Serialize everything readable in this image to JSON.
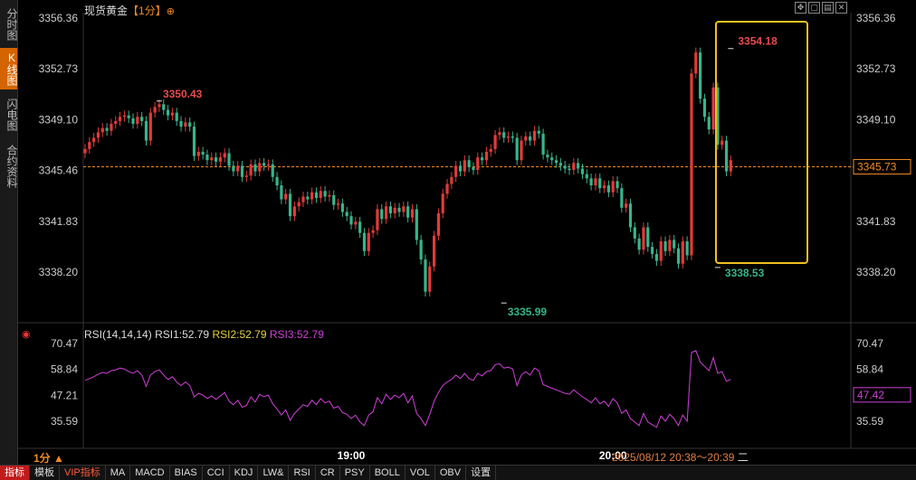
{
  "sidebar": {
    "tabs": [
      {
        "label": "分时图",
        "active": false
      },
      {
        "label": "K线图",
        "active": true
      },
      {
        "label": "闪电图",
        "active": false
      },
      {
        "label": "合约资料",
        "active": false
      }
    ]
  },
  "header": {
    "title": "现货黄金",
    "period": "【1分】",
    "settings_icon": "circle-plus-icon",
    "window_icons": [
      "resize-icon",
      "restore-icon",
      "panel-icon",
      "close-icon"
    ]
  },
  "rsi_panel": {
    "label": "RSI(14,14,14)",
    "rsi1": "RSI1:52.79",
    "rsi2": "RSI2:52.79",
    "rsi3": "RSI3:52.79",
    "current_value": "47.42"
  },
  "footer": {
    "period_label": "1分",
    "time_range": "2025/08/12 20:38～20:39",
    "weekday": "二"
  },
  "toolbar": [
    "指标",
    "模板",
    "VIP指标",
    "MA",
    "MACD",
    "BIAS",
    "CCI",
    "KDJ",
    "LW&",
    "RSI",
    "CR",
    "PSY",
    "BOLL",
    "VOL",
    "OBV",
    "设置"
  ],
  "chart_data": {
    "type": "candlestick",
    "ylim": [
      3334.9,
      3357.0
    ],
    "y_ticks": [
      "3356.36",
      "3352.73",
      "3349.10",
      "3345.46",
      "3341.83",
      "3338.20"
    ],
    "current_price": "3345.73",
    "x_labels": [
      {
        "label": "19:00",
        "index": 61
      },
      {
        "label": "20:00",
        "index": 121
      }
    ],
    "annotations": {
      "high_left": {
        "value": "3350.43",
        "index": 17
      },
      "low": {
        "value": "3335.99",
        "index": 96
      },
      "high_right": {
        "value": "3354.18",
        "index": 148
      },
      "low_right": {
        "value": "3338.53",
        "index": 145
      }
    },
    "close": [
      3347.0,
      3347.5,
      3347.8,
      3348.2,
      3348.5,
      3348.3,
      3348.8,
      3349.0,
      3349.3,
      3349.4,
      3349.2,
      3348.8,
      3349.3,
      3349.0,
      3347.6,
      3349.6,
      3350.0,
      3350.2,
      3349.8,
      3349.4,
      3349.6,
      3349.0,
      3348.6,
      3348.9,
      3348.6,
      3346.5,
      3346.8,
      3346.6,
      3346.2,
      3346.4,
      3346.1,
      3346.4,
      3346.7,
      3345.8,
      3345.4,
      3345.8,
      3345.0,
      3345.1,
      3345.9,
      3345.4,
      3346.0,
      3345.8,
      3345.9,
      3345.0,
      3344.4,
      3343.4,
      3343.8,
      3342.2,
      3342.9,
      3343.2,
      3343.6,
      3343.4,
      3343.9,
      3343.5,
      3344.0,
      3343.6,
      3343.7,
      3343.0,
      3343.1,
      3342.5,
      3342.2,
      3341.6,
      3341.8,
      3341.0,
      3339.7,
      3341.0,
      3341.2,
      3342.7,
      3342.0,
      3342.9,
      3342.4,
      3342.8,
      3342.5,
      3342.9,
      3342.1,
      3342.7,
      3340.5,
      3339.1,
      3336.8,
      3338.6,
      3340.8,
      3342.4,
      3343.8,
      3344.5,
      3345.0,
      3345.8,
      3345.4,
      3346.2,
      3345.7,
      3345.5,
      3346.4,
      3346.2,
      3346.8,
      3347.0,
      3348.0,
      3348.2,
      3347.8,
      3347.9,
      3347.8,
      3346.2,
      3347.6,
      3347.9,
      3347.6,
      3348.3,
      3348.1,
      3346.6,
      3346.4,
      3346.2,
      3346.0,
      3345.8,
      3345.6,
      3345.5,
      3346.0,
      3345.6,
      3345.2,
      3344.9,
      3344.4,
      3344.9,
      3344.2,
      3344.4,
      3343.9,
      3344.7,
      3344.2,
      3342.8,
      3343.1,
      3341.4,
      3340.6,
      3339.8,
      3341.4,
      3340.0,
      3339.5,
      3339.0,
      3340.4,
      3339.7,
      3340.5,
      3339.9,
      3338.8,
      3340.4,
      3339.4,
      3352.4,
      3353.9,
      3350.6,
      3349.3,
      3348.4,
      3351.4,
      3347.3,
      3347.6,
      3345.4,
      3346.2
    ],
    "open": [
      3346.7,
      3347.0,
      3347.5,
      3347.8,
      3348.2,
      3348.5,
      3348.3,
      3348.8,
      3349.0,
      3349.3,
      3349.4,
      3349.2,
      3348.8,
      3349.3,
      3349.0,
      3347.6,
      3349.6,
      3350.0,
      3350.2,
      3349.8,
      3349.4,
      3349.6,
      3349.0,
      3348.6,
      3348.9,
      3348.6,
      3346.5,
      3346.8,
      3346.6,
      3346.2,
      3346.4,
      3346.1,
      3346.4,
      3346.7,
      3345.8,
      3345.4,
      3345.8,
      3345.0,
      3345.1,
      3345.9,
      3345.4,
      3346.0,
      3345.8,
      3345.9,
      3345.0,
      3344.4,
      3343.4,
      3343.8,
      3342.2,
      3342.9,
      3343.2,
      3343.6,
      3343.4,
      3343.9,
      3343.5,
      3344.0,
      3343.6,
      3343.7,
      3343.0,
      3343.1,
      3342.5,
      3342.2,
      3341.6,
      3341.8,
      3341.0,
      3339.7,
      3341.0,
      3341.2,
      3342.7,
      3342.0,
      3342.9,
      3342.4,
      3342.8,
      3342.5,
      3342.9,
      3342.1,
      3342.7,
      3340.5,
      3339.1,
      3336.8,
      3338.6,
      3340.8,
      3342.4,
      3343.8,
      3344.5,
      3345.0,
      3345.8,
      3345.4,
      3346.2,
      3345.7,
      3345.5,
      3346.4,
      3346.2,
      3346.8,
      3347.0,
      3348.0,
      3348.2,
      3347.8,
      3347.9,
      3347.8,
      3346.2,
      3347.6,
      3347.9,
      3347.6,
      3348.3,
      3348.1,
      3346.6,
      3346.4,
      3346.2,
      3346.0,
      3345.8,
      3345.6,
      3345.5,
      3346.0,
      3345.6,
      3345.2,
      3344.9,
      3344.4,
      3344.9,
      3344.2,
      3344.4,
      3343.9,
      3344.7,
      3344.2,
      3342.8,
      3343.1,
      3341.4,
      3340.6,
      3339.8,
      3341.4,
      3340.0,
      3339.5,
      3339.0,
      3340.4,
      3339.7,
      3340.5,
      3339.9,
      3338.8,
      3340.4,
      3339.4,
      3352.4,
      3353.9,
      3350.6,
      3349.3,
      3348.4,
      3351.4,
      3347.3,
      3347.6,
      3345.4
    ],
    "rsi": [
      56,
      58,
      60,
      63,
      65,
      64,
      67,
      68,
      70,
      69,
      66,
      64,
      67,
      62,
      49,
      62,
      66,
      68,
      62,
      57,
      60,
      54,
      50,
      54,
      50,
      37,
      41,
      39,
      35,
      38,
      34,
      38,
      42,
      32,
      28,
      33,
      25,
      27,
      37,
      31,
      40,
      37,
      39,
      29,
      23,
      16,
      22,
      10,
      18,
      23,
      28,
      26,
      33,
      28,
      35,
      30,
      32,
      24,
      26,
      19,
      17,
      12,
      16,
      8,
      4,
      16,
      20,
      36,
      29,
      40,
      34,
      39,
      36,
      41,
      30,
      38,
      18,
      12,
      4,
      17,
      32,
      42,
      50,
      54,
      57,
      62,
      58,
      64,
      58,
      56,
      64,
      61,
      66,
      67,
      74,
      75,
      70,
      71,
      69,
      50,
      62,
      66,
      62,
      70,
      67,
      51,
      49,
      47,
      45,
      43,
      41,
      40,
      45,
      41,
      37,
      34,
      30,
      36,
      29,
      32,
      26,
      35,
      30,
      18,
      22,
      12,
      8,
      4,
      18,
      8,
      5,
      2,
      15,
      9,
      17,
      12,
      4,
      16,
      9,
      88,
      90,
      77,
      72,
      67,
      82,
      64,
      66,
      55,
      57
    ]
  }
}
